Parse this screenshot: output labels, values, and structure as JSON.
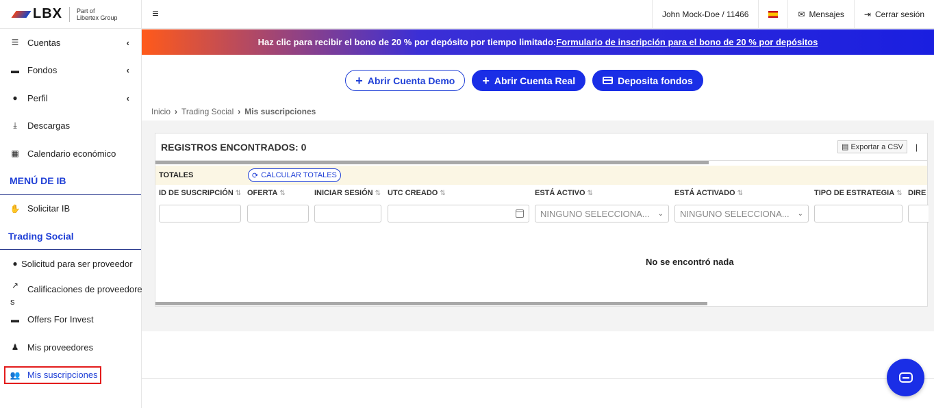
{
  "logo": {
    "brand": "LBX",
    "sub_line1": "Part of",
    "sub_line2": "Libertex Group"
  },
  "topbar": {
    "user": "John Mock-Doe / 11466",
    "messages": "Mensajes",
    "logout": "Cerrar sesión"
  },
  "banner": {
    "text": "Haz clic para recibir el bono de 20 % por depósito por tiempo limitado:",
    "link": "Formulario de inscripción para el bono de 20 % por depósitos"
  },
  "sidebar": {
    "items": [
      {
        "label": "Cuentas",
        "icon": "list-icon",
        "chevron": "‹"
      },
      {
        "label": "Fondos",
        "icon": "wallet-icon",
        "chevron": "‹"
      },
      {
        "label": "Perfil",
        "icon": "user-icon",
        "chevron": "‹"
      },
      {
        "label": "Descargas",
        "icon": "download-icon"
      },
      {
        "label": "Calendario económico",
        "icon": "calendar-icon"
      }
    ],
    "ib_section": "MENÚ DE IB",
    "ib_items": [
      {
        "label": "Solicitar IB",
        "icon": "handshake-icon"
      }
    ],
    "social_section": "Trading Social",
    "social_items": [
      {
        "label": "Solicitud para ser proveedor",
        "icon": "user-icon"
      },
      {
        "label_line1": "Calificaciones de proveedore",
        "label_line2": "s",
        "icon": "chart-line-icon"
      },
      {
        "label": "Offers For Invest",
        "icon": "wallet-icon"
      },
      {
        "label": "Mis proveedores",
        "icon": "user-tie-icon"
      },
      {
        "label": "Mis suscripciones",
        "icon": "users-icon",
        "active": true
      }
    ]
  },
  "actions": {
    "demo": "Abrir Cuenta Demo",
    "real": "Abrir Cuenta Real",
    "deposit": "Deposita fondos"
  },
  "breadcrumb": {
    "home": "Inicio",
    "section": "Trading Social",
    "current": "Mis suscripciones"
  },
  "panel": {
    "title": "REGISTROS ENCONTRADOS: 0",
    "export": "Exportar a CSV",
    "pipe": "|",
    "totals_label": "TOTALES",
    "calc_button": "CALCULAR TOTALES",
    "columns": [
      "ID DE SUSCRIPCIÓN",
      "OFERTA",
      "INICIAR SESIÓN",
      "UTC CREADO",
      "ESTÁ ACTIVO",
      "ESTÁ ACTIVADO",
      "TIPO DE ESTRATEGIA",
      "DIRE"
    ],
    "select_placeholder_1": "NINGUNO SELECCIONA...",
    "select_placeholder_2": "NINGUNO SELECCIONA...",
    "empty": "No se encontró nada"
  },
  "colors": {
    "accent": "#1a2ee6",
    "highlight_border": "#e31b1b",
    "totals_bg": "#fbf6e4"
  }
}
